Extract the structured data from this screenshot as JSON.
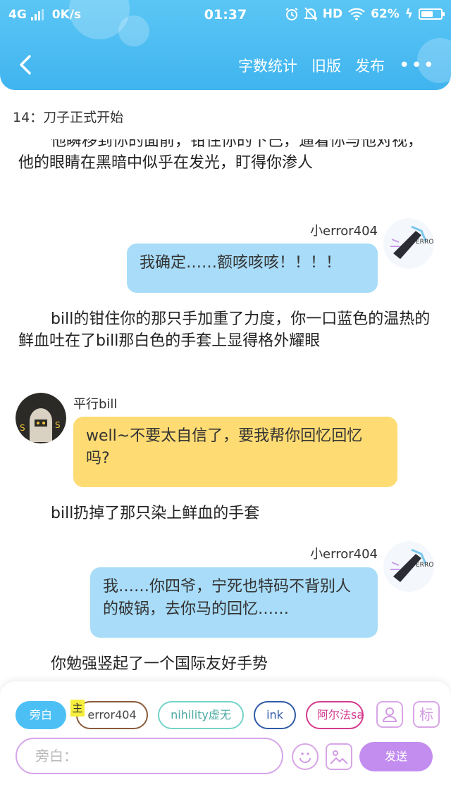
{
  "status_bar": {
    "network": "4G",
    "speed": "0K/s",
    "time": "01:37",
    "hd": "HD",
    "battery_text": "62%",
    "battery_level": 0.62
  },
  "nav": {
    "word_count": "字数统计",
    "old_version": "旧版",
    "publish": "发布"
  },
  "chapter_title": "14：刀子正式开始",
  "messages": [
    {
      "type": "narration",
      "text": "他瞬移到你的面前，钳住你的下巴，逼着你与他对视，他的眼睛在黑暗中似乎在发光，盯得你渗人"
    },
    {
      "type": "right",
      "name": "小error404",
      "text": "我确定……额咳咳咳！！！！"
    },
    {
      "type": "narration",
      "text": "bill的钳住你的那只手加重了力度，你一口蓝色的温热的鲜血吐在了bill那白色的手套上显得格外耀眼"
    },
    {
      "type": "left",
      "name": "平行bill",
      "text": "well~不要太自信了，要我帮你回忆回忆吗?"
    },
    {
      "type": "narration",
      "text": "bill扔掉了那只染上鲜血的手套"
    },
    {
      "type": "right",
      "name": "小error404",
      "text": "我……你四爷，宁死也特码不背别人的破锅，去你马的回忆……"
    },
    {
      "type": "narration",
      "text": "你勉强竖起了一个国际友好手势"
    }
  ],
  "roles": {
    "narrator": "旁白",
    "main_tag": "主",
    "chips": [
      "error404",
      "nihility虚无",
      "ink",
      "阿尔法sa"
    ]
  },
  "tool_buttons": {
    "role_icon": "person-icon",
    "tag_label": "标"
  },
  "composer": {
    "placeholder": "旁白：",
    "send": "发送"
  },
  "colors": {
    "header": "#45b8f0",
    "right_bubble": "#a8dcf8",
    "left_bubble": "#fedb73",
    "accent": "#c38df0"
  }
}
